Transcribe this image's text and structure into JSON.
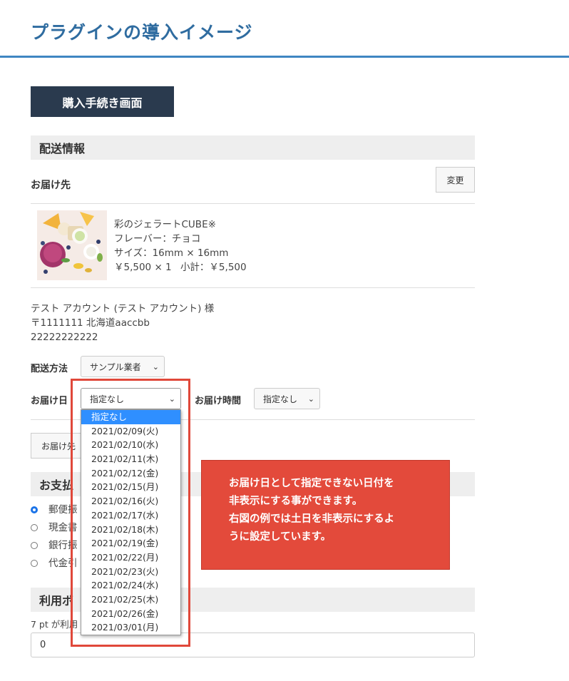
{
  "page_title": "プラグインの導入イメージ",
  "checkout_button": "購入手続き画面",
  "shipping": {
    "section_title": "配送情報",
    "destination_label": "お届け先",
    "change_button": "変更",
    "product": {
      "name": "彩のジェラートCUBE※",
      "flavor": "フレーバー：チョコ",
      "size": "サイズ：16mm × 16mm",
      "price": "￥5,500 × 1",
      "subtotal": "小計：￥5,500"
    },
    "address": {
      "name": "テスト アカウント (テスト アカウント) 様",
      "postal": "〒1111111 北海道aaccbb",
      "phone": "22222222222"
    },
    "method_label": "配送方法",
    "method_value": "サンプル業者",
    "date_label": "お届け日",
    "date_value": "指定なし",
    "time_label": "お届け時間",
    "time_value": "指定なし",
    "date_options": [
      "指定なし",
      "2021/02/09(火)",
      "2021/02/10(水)",
      "2021/02/11(木)",
      "2021/02/12(金)",
      "2021/02/15(月)",
      "2021/02/16(火)",
      "2021/02/17(水)",
      "2021/02/18(木)",
      "2021/02/19(金)",
      "2021/02/22(月)",
      "2021/02/23(火)",
      "2021/02/24(水)",
      "2021/02/25(木)",
      "2021/02/26(金)",
      "2021/03/01(月)"
    ],
    "add_destination_button": "お届け先"
  },
  "payment": {
    "section_title": "お支払",
    "options": [
      "郵便振",
      "現金書",
      "銀行振",
      "代金引"
    ]
  },
  "points": {
    "section_title": "利用ポ",
    "available_text": "7 pt が利用",
    "input_value": "0"
  },
  "callout": {
    "line1": "お届け日として指定できない日付を",
    "line2": "非表示にする事ができます。",
    "line3": "右図の例では土日を非表示にするよ",
    "line4": "うに設定しています。"
  }
}
